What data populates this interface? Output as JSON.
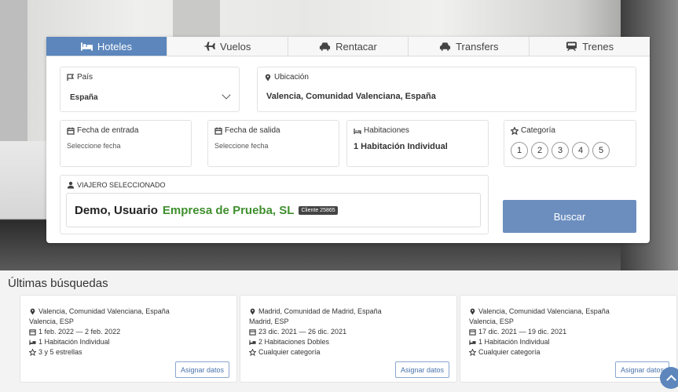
{
  "tabs": [
    {
      "label": "Hoteles",
      "icon": "bed-icon",
      "active": true
    },
    {
      "label": "Vuelos",
      "icon": "plane-icon",
      "active": false
    },
    {
      "label": "Rentacar",
      "icon": "car-icon",
      "active": false
    },
    {
      "label": "Transfers",
      "icon": "car-icon",
      "active": false
    },
    {
      "label": "Trenes",
      "icon": "train-icon",
      "active": false
    }
  ],
  "form": {
    "pais_label": "País",
    "pais_value": "España",
    "ubicacion_label": "Ubicación",
    "ubicacion_value": "Valencia, Comunidad Valenciana, España",
    "entrada_label": "Fecha de entrada",
    "entrada_placeholder": "Seleccione fecha",
    "salida_label": "Fecha de salida",
    "salida_placeholder": "Seleccione fecha",
    "habitaciones_label": "Habitaciones",
    "habitaciones_value": "1 Habitación Individual",
    "categoria_label": "Categoría",
    "categoria_options": [
      "1",
      "2",
      "3",
      "4",
      "5"
    ],
    "viajero_label": "VIAJERO SELECCIONADO",
    "viajero_name": "Demo, Usuario",
    "viajero_company": "Empresa de Prueba, SL",
    "viajero_badge": "Cliente 25865",
    "buscar_label": "Buscar"
  },
  "recent": {
    "title": "Últimas búsquedas",
    "items": [
      {
        "location": "Valencia, Comunidad Valenciana, España",
        "code": "Valencia, ESP",
        "dates": "1 feb. 2022 — 2 feb. 2022",
        "rooms": "1 Habitación Individual",
        "category": "3 y 5 estrellas",
        "button": "Asignar datos"
      },
      {
        "location": "Madrid, Comunidad de Madrid, España",
        "code": "Madrid, ESP",
        "dates": "23 dic. 2021 — 26 dic. 2021",
        "rooms": "2 Habitaciones Dobles",
        "category": "Cualquier categoría",
        "button": "Asignar datos"
      },
      {
        "location": "Valencia, Comunidad Valenciana, España",
        "code": "Valencia, ESP",
        "dates": "17 dic. 2021 — 19 dic. 2021",
        "rooms": "1 Habitación Individual",
        "category": "Cualquier categoría",
        "button": "Asignar datos"
      }
    ]
  },
  "colors": {
    "accent": "#5c86bc",
    "button": "#6c8ebf",
    "company": "#3f8f2e"
  }
}
